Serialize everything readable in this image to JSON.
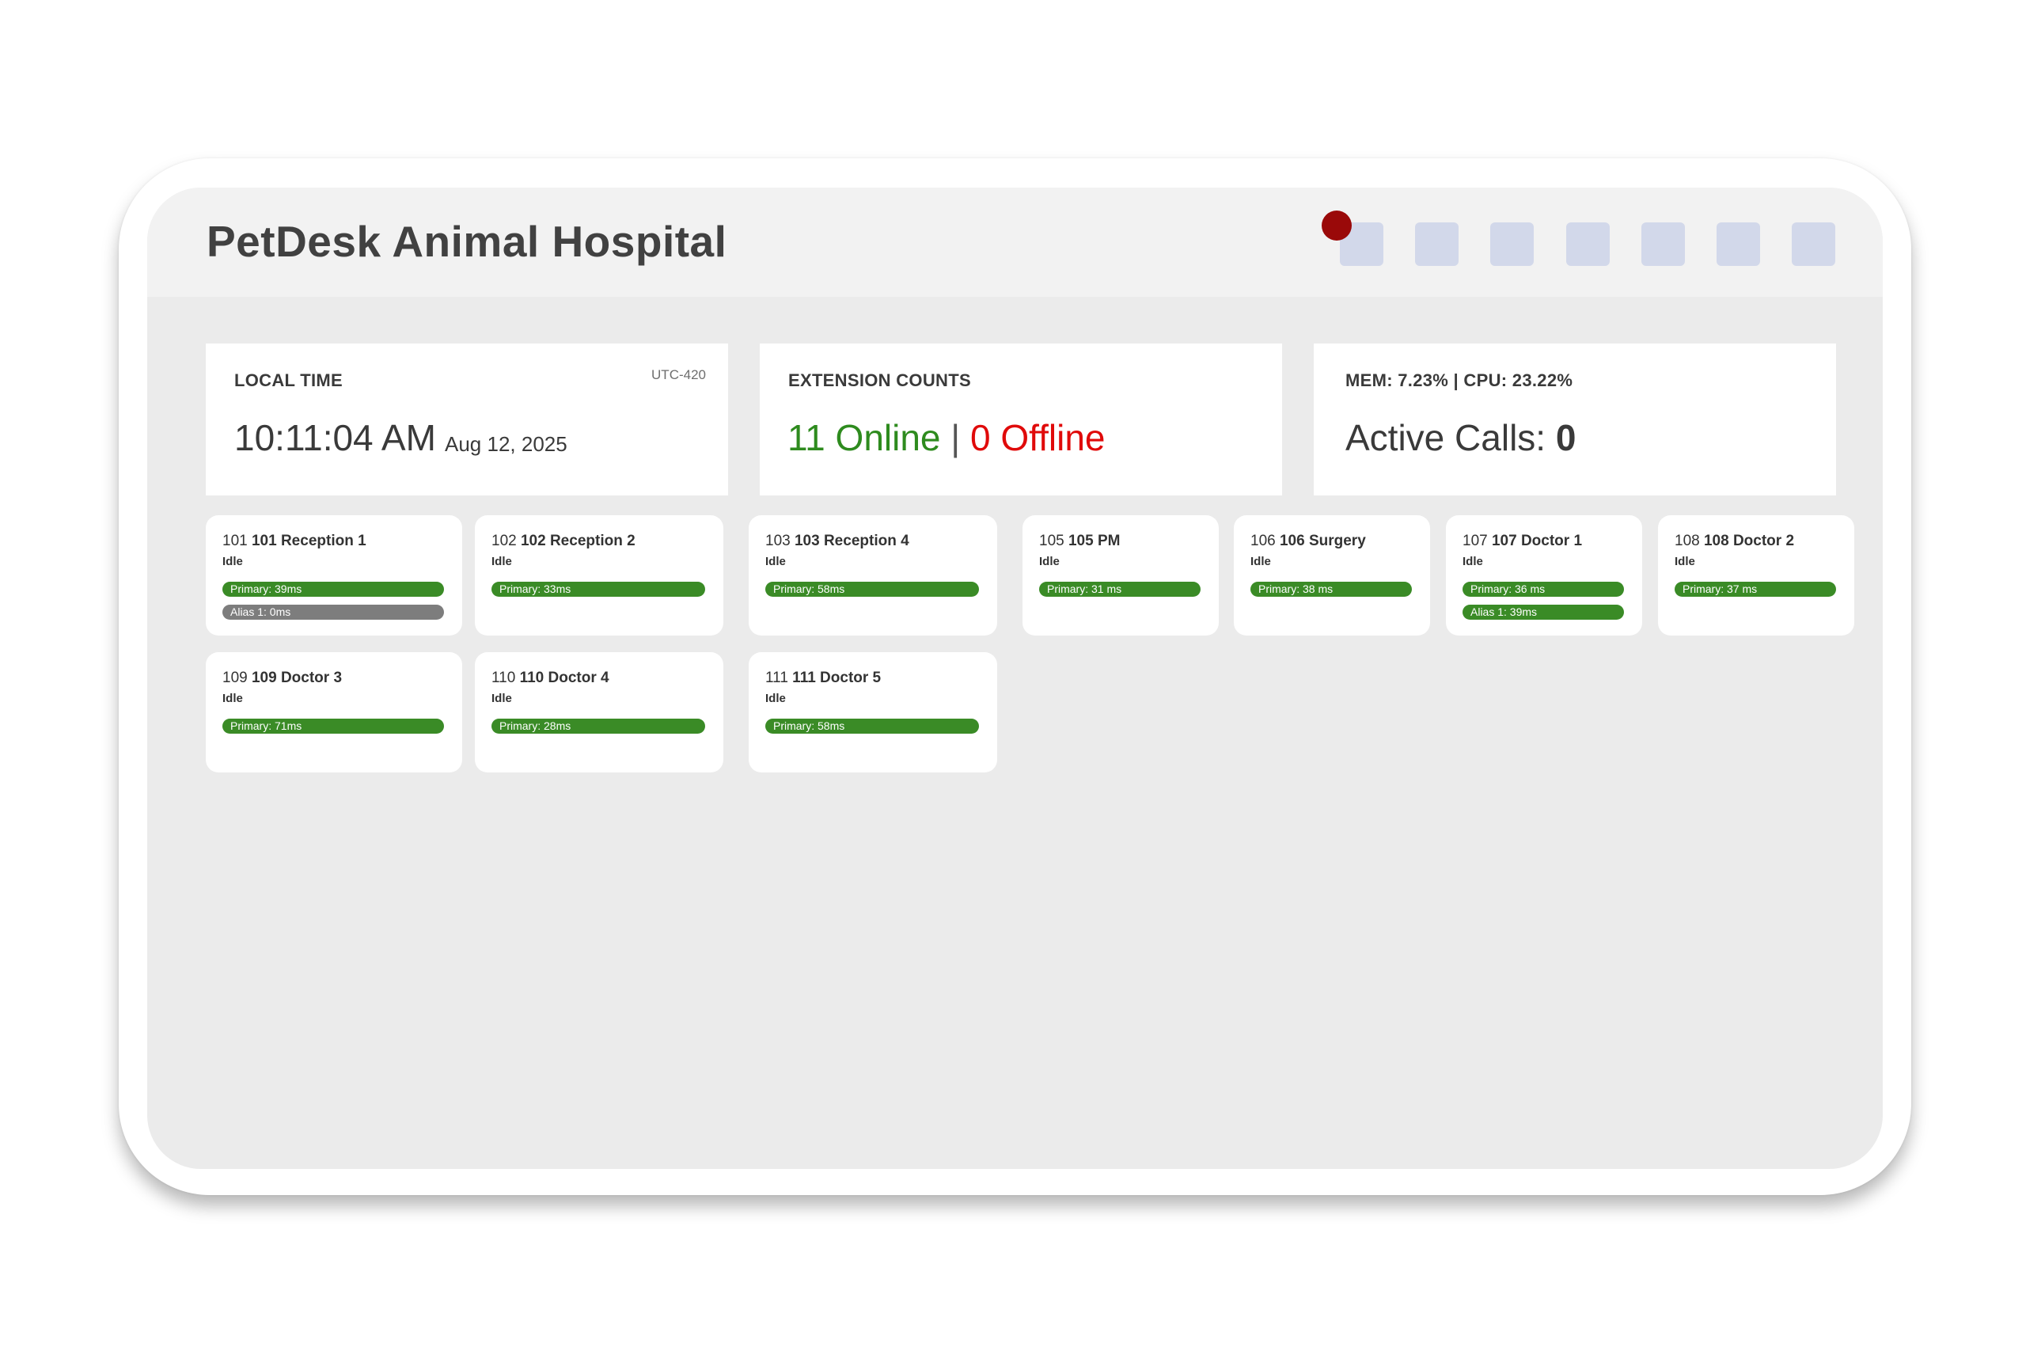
{
  "header": {
    "title": "PetDesk Animal Hospital",
    "toolbar_buttons": [
      "btn-1",
      "btn-2",
      "btn-3",
      "btn-4",
      "btn-5",
      "btn-6",
      "btn-7"
    ]
  },
  "stats": {
    "local_time": {
      "label": "LOCAL TIME",
      "timezone": "UTC-420",
      "time": "10:11:04 AM",
      "date": "Aug 12, 2025"
    },
    "extension_counts": {
      "label": "EXTENSION COUNTS",
      "online": "11 Online",
      "separator": "|",
      "offline": "0 Offline"
    },
    "system": {
      "label": "MEM: 7.23% | CPU: 23.22%",
      "active_calls_label": "Active Calls:",
      "active_calls_value": "0"
    }
  },
  "extensions": [
    {
      "num": "101",
      "name": "101 Reception 1",
      "status": "Idle",
      "bars": [
        {
          "text": "Primary: 39ms",
          "state": "ok"
        },
        {
          "text": "Alias 1: 0ms",
          "state": "inactive"
        }
      ]
    },
    {
      "num": "102",
      "name": "102 Reception 2",
      "status": "Idle",
      "bars": [
        {
          "text": "Primary: 33ms",
          "state": "ok"
        }
      ]
    },
    {
      "num": "103",
      "name": "103 Reception 4",
      "status": "Idle",
      "bars": [
        {
          "text": "Primary: 58ms",
          "state": "ok"
        }
      ]
    },
    {
      "num": "105",
      "name": "105 PM",
      "status": "Idle",
      "bars": [
        {
          "text": "Primary: 31 ms",
          "state": "ok"
        }
      ]
    },
    {
      "num": "106",
      "name": "106 Surgery",
      "status": "Idle",
      "bars": [
        {
          "text": "Primary: 38 ms",
          "state": "ok"
        }
      ]
    },
    {
      "num": "107",
      "name": "107 Doctor 1",
      "status": "Idle",
      "bars": [
        {
          "text": "Primary: 36 ms",
          "state": "ok"
        },
        {
          "text": "Alias 1: 39ms",
          "state": "ok"
        }
      ]
    },
    {
      "num": "108",
      "name": "108 Doctor 2",
      "status": "Idle",
      "bars": [
        {
          "text": "Primary: 37 ms",
          "state": "ok"
        }
      ]
    },
    {
      "num": "109",
      "name": "109 Doctor 3",
      "status": "Idle",
      "bars": [
        {
          "text": "Primary: 71ms",
          "state": "ok"
        }
      ]
    },
    {
      "num": "110",
      "name": "110 Doctor 4",
      "status": "Idle",
      "bars": [
        {
          "text": "Primary: 28ms",
          "state": "ok"
        }
      ]
    },
    {
      "num": "111",
      "name": "111 Doctor 5",
      "status": "Idle",
      "bars": [
        {
          "text": "Primary: 58ms",
          "state": "ok"
        }
      ]
    }
  ],
  "colors": {
    "online": "#2e8b1e",
    "offline": "#e00a0a",
    "bar_ok": "#3a8b26",
    "bar_inactive": "#7d7d7d",
    "recording_dot": "#9a0909"
  }
}
